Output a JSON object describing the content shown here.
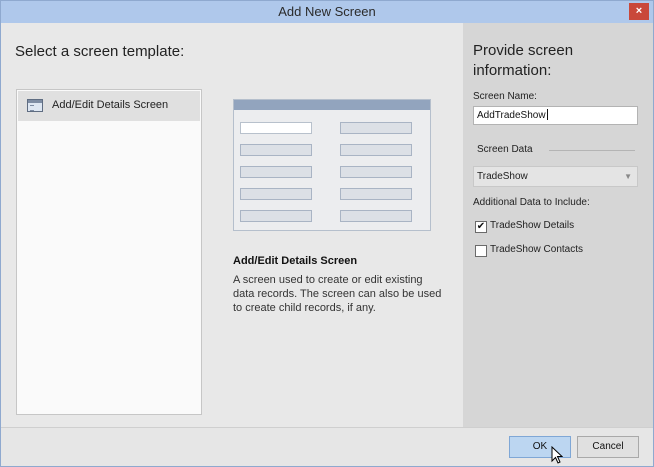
{
  "window": {
    "title": "Add New Screen",
    "close_glyph": "×"
  },
  "left": {
    "heading": "Select a screen template:",
    "templates": [
      {
        "label": "Add/Edit Details Screen",
        "icon": "screen-template-icon"
      }
    ],
    "description": {
      "title": "Add/Edit Details Screen",
      "text": "A screen used to create or edit existing data records. The screen can also be used to create child records, if any."
    }
  },
  "right": {
    "heading": "Provide screen information:",
    "screen_name_label": "Screen Name:",
    "screen_name_value": "AddTradeShow",
    "screen_data_label": "Screen Data",
    "screen_data_value": "TradeShow",
    "additional_label": "Additional Data to Include:",
    "options": [
      {
        "label": "TradeShow Details",
        "checked": true
      },
      {
        "label": "TradeShow Contacts",
        "checked": false
      }
    ]
  },
  "footer": {
    "ok_label": "OK",
    "cancel_label": "Cancel"
  },
  "colors": {
    "titlebar": "#afc8eb",
    "ok_button": "#bcd6f1",
    "right_panel": "#d6d6d6"
  }
}
